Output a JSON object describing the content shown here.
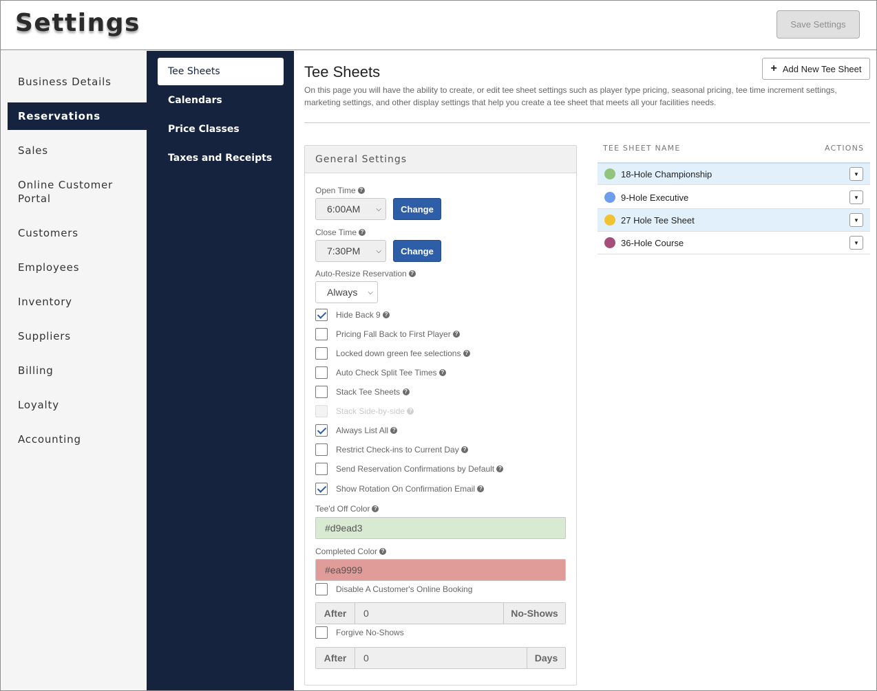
{
  "header": {
    "title": "Settings",
    "save_label": "Save Settings"
  },
  "leftnav": {
    "items": [
      {
        "label": "Business Details"
      },
      {
        "label": "Reservations",
        "active": true
      },
      {
        "label": "Sales"
      },
      {
        "label": "Online Customer Portal"
      },
      {
        "label": "Customers"
      },
      {
        "label": "Employees"
      },
      {
        "label": "Inventory"
      },
      {
        "label": "Suppliers"
      },
      {
        "label": "Billing"
      },
      {
        "label": "Loyalty"
      },
      {
        "label": "Accounting"
      }
    ]
  },
  "subnav": {
    "items": [
      {
        "label": "Tee Sheets",
        "active": true
      },
      {
        "label": "Calendars"
      },
      {
        "label": "Price Classes"
      },
      {
        "label": "Taxes and Receipts"
      }
    ]
  },
  "main": {
    "title": "Tee Sheets",
    "description": "On this page you will have the ability to create, or edit tee sheet settings such as player type pricing, seasonal pricing, tee time increment settings, marketing settings, and other display settings that help you create a tee sheet that meets all your facilities needs.",
    "add_button_label": "Add New Tee Sheet"
  },
  "general": {
    "title": "General Settings",
    "open_time_label": "Open Time",
    "open_time_value": "6:00AM",
    "close_time_label": "Close Time",
    "close_time_value": "7:30PM",
    "change_label": "Change",
    "auto_resize_label": "Auto-Resize Reservation",
    "auto_resize_value": "Always",
    "checkboxes": [
      {
        "label": "Hide Back 9",
        "checked": true
      },
      {
        "label": "Pricing Fall Back to First Player",
        "checked": false
      },
      {
        "label": "Locked down green fee selections",
        "checked": false
      },
      {
        "label": "Auto Check Split Tee Times",
        "checked": false
      },
      {
        "label": "Stack Tee Sheets",
        "checked": false
      },
      {
        "label": "Stack Side-by-side",
        "checked": false,
        "disabled": true
      },
      {
        "label": "Always List All",
        "checked": true
      },
      {
        "label": "Restrict Check-ins to Current Day",
        "checked": false
      },
      {
        "label": "Send Reservation Confirmations by Default",
        "checked": false
      },
      {
        "label": "Show Rotation On Confirmation Email",
        "checked": true
      }
    ],
    "teed_off_color_label": "Tee'd Off Color",
    "teed_off_color_value": "#d9ead3",
    "completed_color_label": "Completed Color",
    "completed_color_value": "#ea9999",
    "disable_online_label": "Disable A Customer's Online Booking",
    "noshow_after_label": "After",
    "noshow_value": "0",
    "noshow_suffix": "No-Shows",
    "forgive_label": "Forgive No-Shows",
    "forgive_after_label": "After",
    "forgive_value": "0",
    "forgive_suffix": "Days"
  },
  "tee_table": {
    "col_name": "TEE SHEET NAME",
    "col_actions": "ACTIONS",
    "rows": [
      {
        "name": "18-Hole Championship",
        "color": "#93c47d"
      },
      {
        "name": "9-Hole Executive",
        "color": "#6d9eeb"
      },
      {
        "name": "27 Hole Tee Sheet",
        "color": "#f1c232"
      },
      {
        "name": "36-Hole Course",
        "color": "#a64d79"
      }
    ]
  }
}
